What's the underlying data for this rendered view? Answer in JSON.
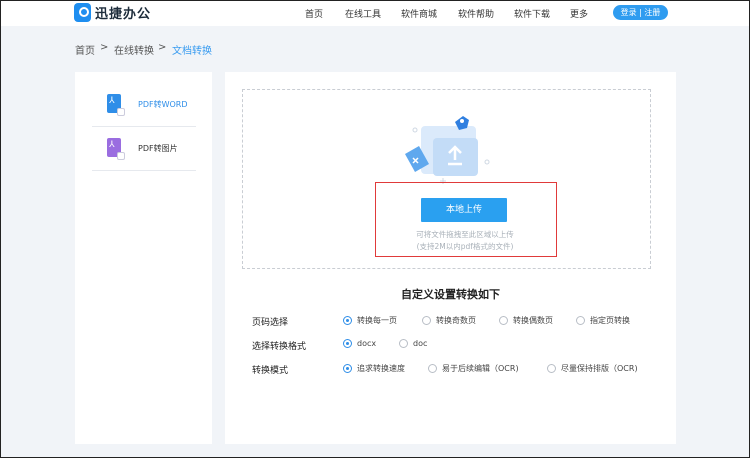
{
  "header": {
    "logo_text": "迅捷办公",
    "nav": [
      "首页",
      "在线工具",
      "软件商城",
      "软件帮助",
      "软件下载",
      "更多"
    ],
    "login_label": "登录 | 注册"
  },
  "breadcrumb": {
    "items": [
      "首页",
      "在线转换",
      "文档转换"
    ],
    "separator": ">"
  },
  "sidebar": {
    "items": [
      {
        "label": "PDF转WORD",
        "icon": "pdf-to-word-icon",
        "color": "#2f8ee8"
      },
      {
        "label": "PDF转图片",
        "icon": "pdf-to-image-icon",
        "color": "#9a6de0"
      }
    ]
  },
  "upload": {
    "button_label": "本地上传",
    "hint_line1": "可将文件拖拽至此区域以上传",
    "hint_line2": "(支持2M以内pdf格式的文件)"
  },
  "settings": {
    "title": "自定义设置转换如下",
    "rows": [
      {
        "label": "页码选择",
        "options": [
          "转换每一页",
          "转换奇数页",
          "转换偶数页",
          "指定页转换"
        ],
        "selected": 0
      },
      {
        "label": "选择转换格式",
        "options": [
          "docx",
          "doc"
        ],
        "selected": 0
      },
      {
        "label": "转换模式",
        "options": [
          "追求转换速度",
          "易于后续编辑（OCR)",
          "尽量保持排版（OCR)"
        ],
        "selected": 0
      }
    ]
  },
  "colors": {
    "accent": "#2aa0f0",
    "highlight_border": "#e03a3a"
  }
}
